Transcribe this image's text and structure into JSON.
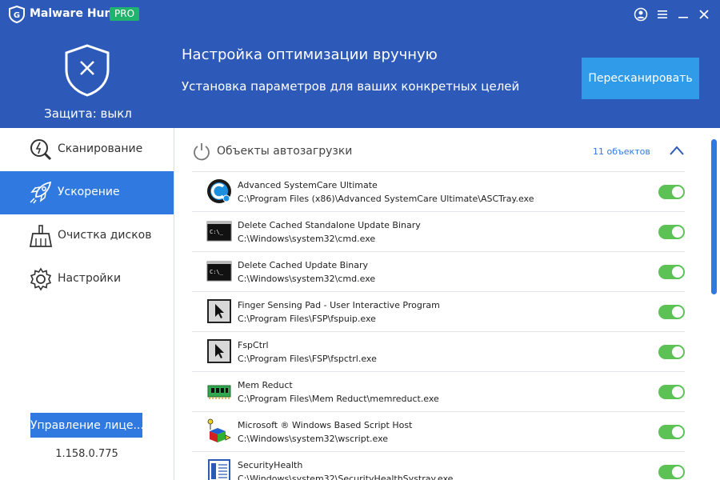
{
  "app": {
    "name": "Malware Hunter",
    "badge": "PRO"
  },
  "titlebar_icons": [
    "account-icon",
    "menu-icon",
    "minimize-icon",
    "close-icon"
  ],
  "status": {
    "text": "Защита: выкл"
  },
  "header": {
    "title": "Настройка оптимизации вручную",
    "subtitle": "Установка параметров для ваших конкретных целей",
    "rescan_label": "Пересканировать"
  },
  "sidebar": {
    "items": [
      {
        "label": "Сканирование",
        "icon": "scan-icon",
        "active": false
      },
      {
        "label": "Ускорение",
        "icon": "rocket-icon",
        "active": true
      },
      {
        "label": "Очистка дисков",
        "icon": "broom-icon",
        "active": false
      },
      {
        "label": "Настройки",
        "icon": "gear-icon",
        "active": false
      }
    ],
    "license_label": "Управление лице...",
    "version": "1.158.0.775"
  },
  "section": {
    "title": "Объекты автозагрузки",
    "count": "11 объектов"
  },
  "colors": {
    "header": "#2d5ab8",
    "accent": "#3079e0",
    "button": "#2f9be9",
    "toggle_on": "#5cc255",
    "badge": "#1fb36b"
  },
  "items": [
    {
      "name": "Advanced SystemCare Ultimate",
      "path": "C:\\Program Files (x86)\\Advanced SystemCare Ultimate\\ASCTray.exe",
      "icon": "advanced-systemcare-icon",
      "enabled": true
    },
    {
      "name": "Delete Cached Standalone Update Binary",
      "path": "C:\\Windows\\system32\\cmd.exe",
      "icon": "cmd-icon",
      "enabled": true
    },
    {
      "name": "Delete Cached Update Binary",
      "path": "C:\\Windows\\system32\\cmd.exe",
      "icon": "cmd-icon",
      "enabled": true
    },
    {
      "name": "Finger Sensing Pad - User Interactive Program",
      "path": "C:\\Program Files\\FSP\\fspuip.exe",
      "icon": "cursor-app-icon",
      "enabled": true
    },
    {
      "name": "FspCtrl",
      "path": "C:\\Program Files\\FSP\\fspctrl.exe",
      "icon": "cursor-app-icon",
      "enabled": true
    },
    {
      "name": "Mem Reduct",
      "path": "C:\\Program Files\\Mem Reduct\\memreduct.exe",
      "icon": "memory-chip-icon",
      "enabled": true
    },
    {
      "name": "Microsoft ® Windows Based Script Host",
      "path": "C:\\Windows\\system32\\wscript.exe",
      "icon": "script-host-icon",
      "enabled": true
    },
    {
      "name": "SecurityHealth",
      "path": "C:\\Windows\\system32\\SecurityHealthSystray.exe",
      "icon": "document-icon",
      "enabled": true
    }
  ]
}
